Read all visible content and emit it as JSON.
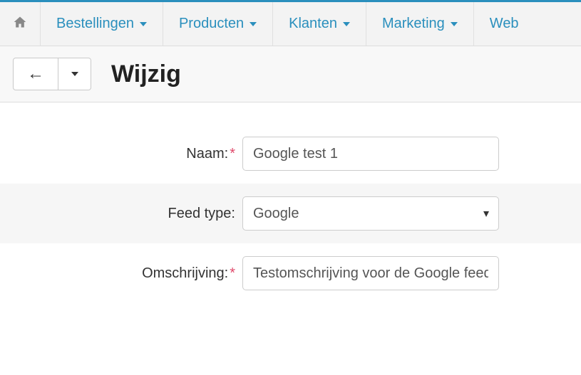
{
  "nav": {
    "items": [
      {
        "label": "Bestellingen"
      },
      {
        "label": "Producten"
      },
      {
        "label": "Klanten"
      },
      {
        "label": "Marketing"
      },
      {
        "label": "Web"
      }
    ]
  },
  "page": {
    "title": "Wijzig"
  },
  "form": {
    "name": {
      "label": "Naam:",
      "value": "Google test 1"
    },
    "feed_type": {
      "label": "Feed type:",
      "selected": "Google"
    },
    "description": {
      "label": "Omschrijving:",
      "value": "Testomschrijving voor de Google feed"
    }
  }
}
